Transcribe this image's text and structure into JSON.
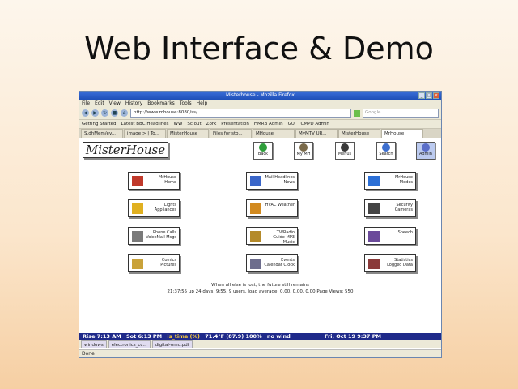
{
  "slide": {
    "title": "Web Interface & Demo"
  },
  "window": {
    "title": "Misterhouse - Mozilla Firefox",
    "menu": [
      "File",
      "Edit",
      "View",
      "History",
      "Bookmarks",
      "Tools",
      "Help"
    ],
    "url": "http://www.mhouse:8080/ss/",
    "search_placeholder": "Google",
    "bookmarks": [
      "Getting Started",
      "Latest BBC Headlines",
      "WW",
      "Sc out",
      "Zork",
      "Presentation",
      "HMRB Admin",
      "GUI",
      "CMPD Admin"
    ],
    "tabs": [
      "S.dhMem/ev...",
      "image > | To...",
      "MisterHouse",
      "Files for sto...",
      "MHouse",
      "MyMTV UR...",
      "MisterHouse",
      "MrHouse"
    ]
  },
  "page": {
    "logo": "MisterHouse",
    "top_buttons": [
      {
        "label": "Back",
        "color": "#2e9e3a"
      },
      {
        "label": "My MH",
        "color": "#7a6a4a"
      },
      {
        "label": "Menus",
        "color": "#3a3a3a"
      },
      {
        "label": "Search",
        "color": "#3d6fcf"
      },
      {
        "label": "Admin",
        "color": "#5a6ec8"
      }
    ],
    "categories": [
      {
        "label": "MrHouse Home",
        "color": "#c0392b"
      },
      {
        "label": "Mail Headlines News",
        "color": "#3a66c9"
      },
      {
        "label": "MrHouse Modes",
        "color": "#2b6fd6"
      },
      {
        "label": "Lights Appliances",
        "color": "#e0b020"
      },
      {
        "label": "HVAC Weather",
        "color": "#d28a1f"
      },
      {
        "label": "Security Cameras",
        "color": "#444444"
      },
      {
        "label": "Phone Calls VoiceMail Msgs",
        "color": "#7a7a7a"
      },
      {
        "label": "TV/Radio Guide MP3 Music",
        "color": "#b48a2a"
      },
      {
        "label": "Speech",
        "color": "#6b4a9a"
      },
      {
        "label": "Comics Pictures",
        "color": "#c9a23a"
      },
      {
        "label": "Events Calendar Clock",
        "color": "#6d6d8d"
      },
      {
        "label": "Statistics Logged Data",
        "color": "#8a3a3a"
      }
    ],
    "status_line1": "When all else is lost, the future still remains",
    "status_line2": "21:37:55 up 24 days, 9:55, 9 users, load average: 0.00, 0.00, 0.00 Page Views: 550"
  },
  "weather": {
    "rise": "Rise 7:13 AM",
    "set": "Sot 6:13 PM",
    "time": "is_time (%)",
    "temp": "71.4°F (87.9) 100%",
    "wind": "no wind",
    "date": "Fri, Oct 19 9:37 PM"
  },
  "findbar": [
    "windows",
    "electronics_cc...",
    "digital-omd.pdf"
  ],
  "statusbar": "Done",
  "colors": {
    "accent": "#1f2a8a"
  }
}
